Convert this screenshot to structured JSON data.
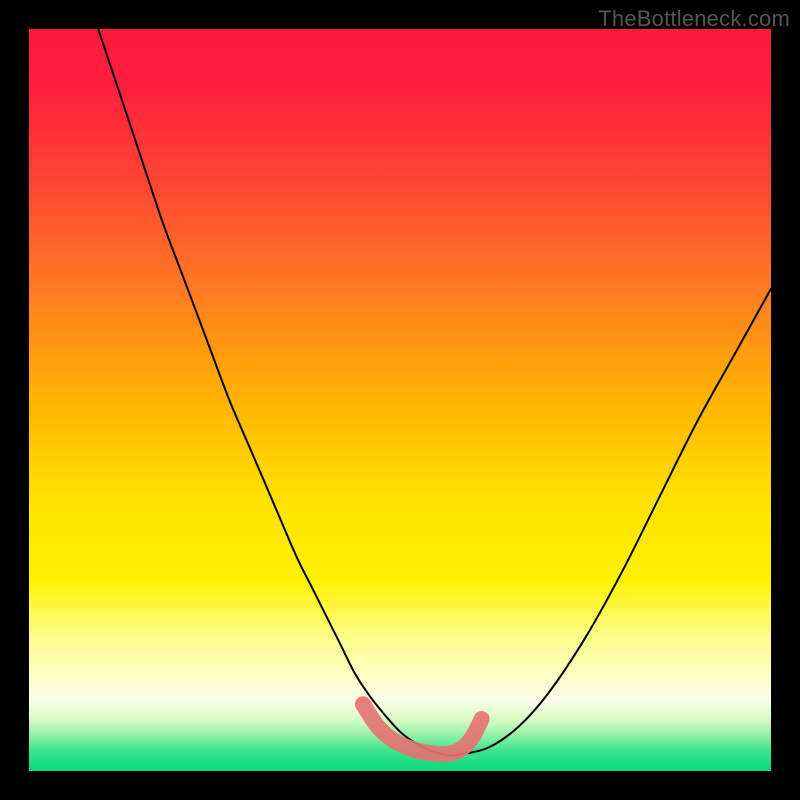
{
  "watermark": "TheBottleneck.com",
  "colors": {
    "frame": "#000000",
    "overlay_pink": "#e57373",
    "curve": "#000000",
    "gradient_stops": [
      {
        "offset": 0.0,
        "color": "#ff1a3c"
      },
      {
        "offset": 0.08,
        "color": "#ff1f3d"
      },
      {
        "offset": 0.2,
        "color": "#ff4433"
      },
      {
        "offset": 0.35,
        "color": "#ff7a24"
      },
      {
        "offset": 0.5,
        "color": "#ffb300"
      },
      {
        "offset": 0.63,
        "color": "#ffe000"
      },
      {
        "offset": 0.74,
        "color": "#fff200"
      },
      {
        "offset": 0.82,
        "color": "#fdfd8a"
      },
      {
        "offset": 0.88,
        "color": "#fefecf"
      },
      {
        "offset": 0.905,
        "color": "#fcfeea"
      },
      {
        "offset": 0.93,
        "color": "#d8fcc5"
      },
      {
        "offset": 0.952,
        "color": "#93f0a8"
      },
      {
        "offset": 0.972,
        "color": "#3ee58f"
      },
      {
        "offset": 0.99,
        "color": "#18dc82"
      },
      {
        "offset": 1.0,
        "color": "#16da80"
      }
    ]
  },
  "chart_data": {
    "type": "line",
    "title": "",
    "xlabel": "",
    "ylabel": "",
    "xlim": [
      0,
      100
    ],
    "ylim": [
      0,
      100
    ],
    "series": [
      {
        "name": "bottleneck-curve",
        "x": [
          9,
          12,
          15,
          18,
          21,
          24,
          27,
          30,
          33,
          36,
          38,
          40,
          42,
          44,
          46,
          48,
          50,
          52,
          54,
          56,
          58,
          62,
          66,
          70,
          75,
          80,
          85,
          90,
          95,
          100
        ],
        "y": [
          101,
          92,
          83,
          74,
          66,
          58,
          50,
          43,
          36,
          29,
          25,
          21,
          17,
          13,
          10,
          7.5,
          5.3,
          3.8,
          2.8,
          2.2,
          2.2,
          3.2,
          6,
          10.5,
          18,
          27,
          37,
          47,
          56,
          65
        ]
      },
      {
        "name": "flat-bottom-overlay",
        "x": [
          45,
          47,
          49,
          51,
          53,
          55,
          56,
          57,
          58,
          59,
          60,
          61
        ],
        "y": [
          9,
          6,
          4.2,
          3.2,
          2.6,
          2.3,
          2.3,
          2.4,
          2.8,
          3.6,
          5,
          7
        ]
      }
    ]
  }
}
